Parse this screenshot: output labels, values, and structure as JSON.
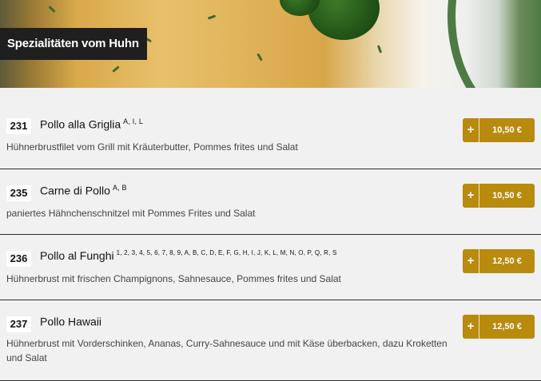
{
  "category": {
    "title": "Spezialitäten vom Huhn"
  },
  "colors": {
    "accent": "#b88a0e",
    "label_bg": "#1f1f1f",
    "page_bg": "#f1f1f1"
  },
  "icons": {
    "add": "plus-icon"
  },
  "items": [
    {
      "number": "231",
      "name": "Pollo alla Griglia",
      "allergens": "A, I, L",
      "description": "Hühnerbrustfilet vom Grill mit Kräuterbutter, Pommes frites und Salat",
      "add_label": "+",
      "price": "10,50 €"
    },
    {
      "number": "235",
      "name": "Carne di Pollo",
      "allergens": "A, B",
      "description": "paniertes Hähnchenschnitzel mit Pommes Frites und Salat",
      "add_label": "+",
      "price": "10,50 €"
    },
    {
      "number": "236",
      "name": "Pollo al Funghi",
      "allergens": "1, 2, 3, 4, 5, 6, 7, 8, 9, A, B, C, D, E, F, G, H, I, J, K, L, M, N, O, P, Q, R, S",
      "description": "Hühnerbrust mit frischen Champignons, Sahnesauce, Pommes frites und Salat",
      "add_label": "+",
      "price": "12,50 €"
    },
    {
      "number": "237",
      "name": "Pollo Hawaii",
      "allergens": "",
      "description": "Hühnerbrust mit Vorderschinken, Ananas, Curry-Sahnesauce und mit Käse überbacken, dazu Kroketten und Salat",
      "add_label": "+",
      "price": "12,50 €"
    }
  ]
}
